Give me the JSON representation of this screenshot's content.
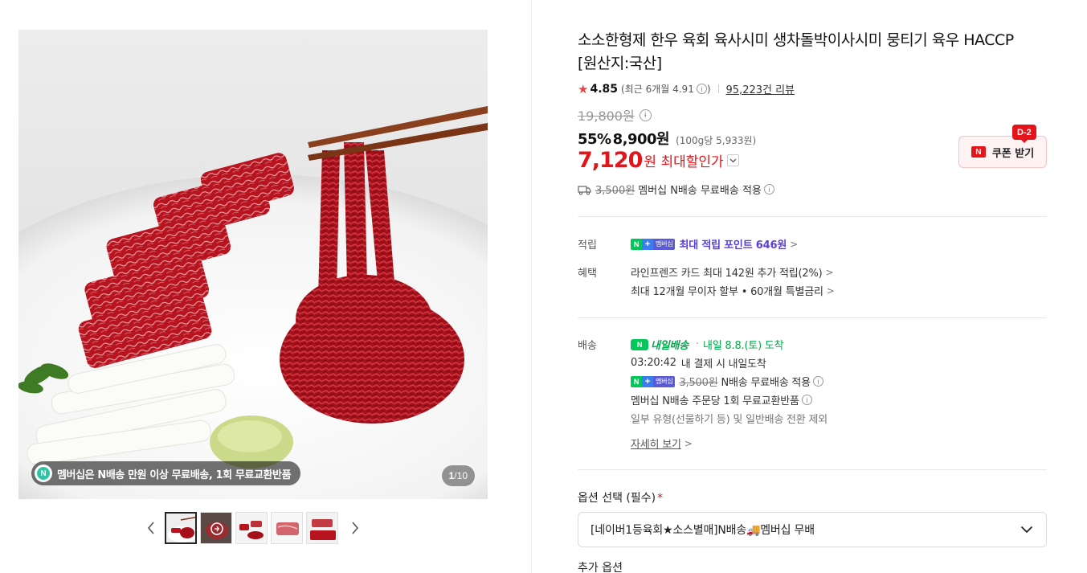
{
  "gallery": {
    "membership_text": "멤버십은 N배송 만원 이상 무료배송, 1회 무료교환반품",
    "membership_icon_letter": "N",
    "counter_current": "1",
    "counter_sep": "/",
    "counter_total": "10",
    "thumbnails": [
      "thumb-1",
      "thumb-2",
      "thumb-3",
      "thumb-4",
      "thumb-5"
    ]
  },
  "product": {
    "title": "소소한형제 한우 육회 육사시미 생차돌박이사시미 뭉티기 육우 HACCP [원산지:국산]",
    "rating": "4.85",
    "recent_rating": "(최근 6개월 4.91",
    "recent_close": ")",
    "review_count": "95,223건 리뷰",
    "original_price": "19,800원",
    "discount": "55%",
    "sale_price": "8,900원",
    "unit_price": "(100g당 5,933원)",
    "max_discount_price": "7,120",
    "max_discount_label": "원 최대할인가",
    "shipping_original": "3,500원",
    "shipping_text": "멤버십 N배송 무료배송 적용"
  },
  "coupon": {
    "dday": "D-2",
    "logo": "N",
    "label": "쿠폰 받기"
  },
  "benefits": {
    "points_label": "적립",
    "points_text": "최대 적립 포인트 646원",
    "benefit_label": "혜택",
    "benefit_line1": "라인프렌즈 카드 최대 142원 추가 적립(2%)",
    "benefit_line2": "최대 12개월 무이자 할부 • 60개월 특별금리"
  },
  "delivery": {
    "label": "배송",
    "badge": "내일배송",
    "arrival": "내일 8.8.(토) 도착",
    "countdown": "03:20:42",
    "countdown_text": "내 결제 시 내일도착",
    "free_original": "3,500원",
    "free_text": "N배송 무료배송 적용",
    "return_text": "멤버십 N배송 주문당 1회 무료교환반품",
    "exclusion_text": "일부 유형(선물하기 등) 및 일반배송 전환 제외",
    "detail_link": "자세히 보기"
  },
  "membership_badge": {
    "n": "N",
    "plus": "+",
    "m": "멤버십"
  },
  "options": {
    "label": "옵션 선택 (필수)",
    "required_mark": "*",
    "selected": "[네이버1등육회★소스별매]N배송🚚멤버십 무배",
    "addon_label": "추가 옵션"
  },
  "colors": {
    "accent_red": "#e4141a",
    "naver_green": "#03c75a",
    "point_purple": "#5a3fd8"
  }
}
